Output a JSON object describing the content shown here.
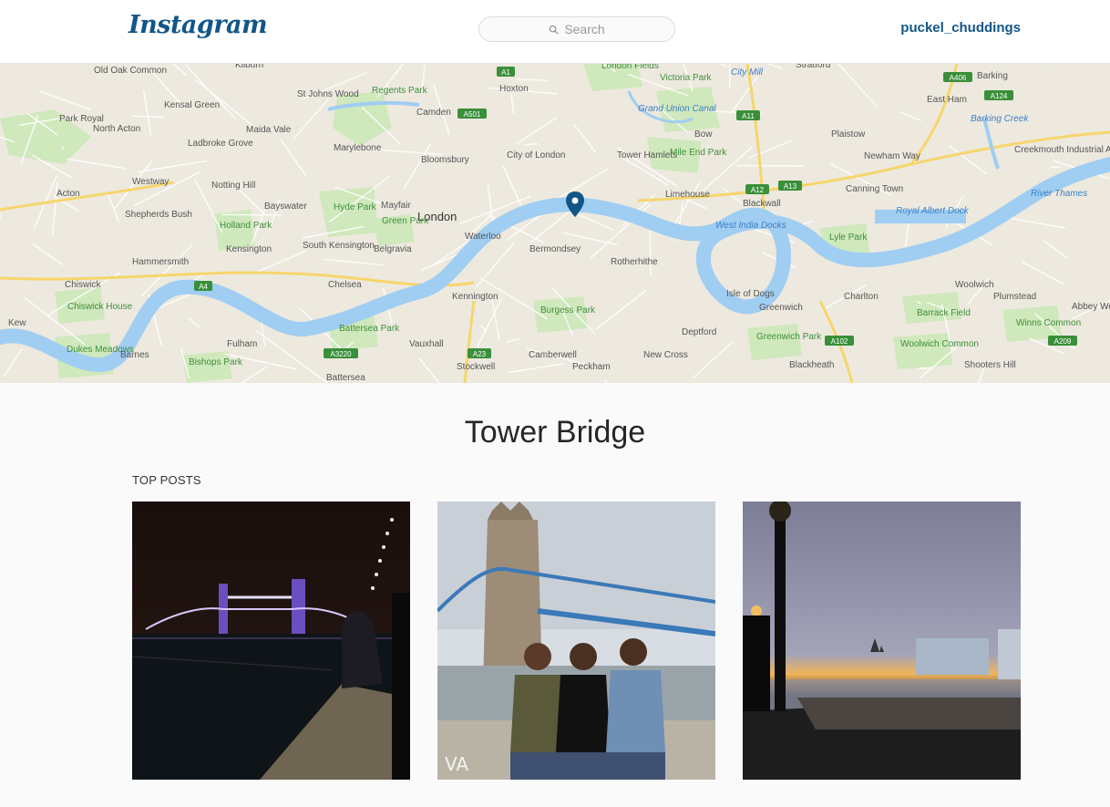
{
  "header": {
    "logo_text": "Instagram",
    "search_placeholder": "Search",
    "username": "puckel_chuddings"
  },
  "map": {
    "labels": [
      "Old Oak Common",
      "Kilburn",
      "London Fields",
      "Victoria Park",
      "City Mill",
      "Stratford",
      "Barking",
      "Hoxton",
      "Kensal Green",
      "St Johns Wood",
      "Regents Park",
      "Camden",
      "Grand Union Canal",
      "East Ham",
      "Park Royal",
      "North Acton",
      "Maida Vale",
      "Bow",
      "Barking Creek",
      "Ladbroke Grove",
      "Marylebone",
      "City of London",
      "Tower Hamlets",
      "Mile End Park",
      "Plaistow",
      "Creekmouth Industrial Area",
      "Bloomsbury",
      "Newham Way",
      "Westway",
      "Notting Hill",
      "Limehouse",
      "Canning Town",
      "River Thames",
      "Acton",
      "Bayswater",
      "Hyde Park",
      "Mayfair",
      "Blackwall",
      "Shepherds Bush",
      "London",
      "Green Park",
      "West India Docks",
      "Royal Albert Dock",
      "Holland Park",
      "Waterloo",
      "Bermondsey",
      "Lyle Park",
      "Kensington",
      "South Kensington",
      "Belgravia",
      "Rotherhithe",
      "Hammersmith",
      "Chelsea",
      "Isle of Dogs",
      "Woolwich",
      "Chiswick",
      "Kennington",
      "Charlton",
      "Plumstead",
      "Chiswick House",
      "Burgess Park",
      "Greenwich",
      "Barrack Field",
      "Abbey Wood",
      "Kew",
      "Battersea Park",
      "Deptford",
      "Winns Common",
      "Dukes Meadows",
      "Barnes",
      "Fulham",
      "Vauxhall",
      "Camberwell",
      "New Cross",
      "Greenwich Park",
      "Woolwich Common",
      "Bishops Park",
      "Stockwell",
      "Peckham",
      "Blackheath",
      "Shooters Hill",
      "Battersea"
    ],
    "road_badges": [
      "A1",
      "A501",
      "A11",
      "A406",
      "A124",
      "A12",
      "A13",
      "A4",
      "A3220",
      "A23",
      "A102",
      "A209"
    ]
  },
  "location_title": "Tower Bridge",
  "section_label": "TOP POSTS",
  "posts": [
    {
      "description": "Tower Bridge at night"
    },
    {
      "description": "Three friends in front of Tower Bridge",
      "watermark": "VA"
    },
    {
      "description": "Thames riverside at sunset"
    }
  ],
  "colors": {
    "brand": "#125688",
    "water": "#a0cdf2",
    "park": "#c7e6b3",
    "pin": "#125688"
  }
}
